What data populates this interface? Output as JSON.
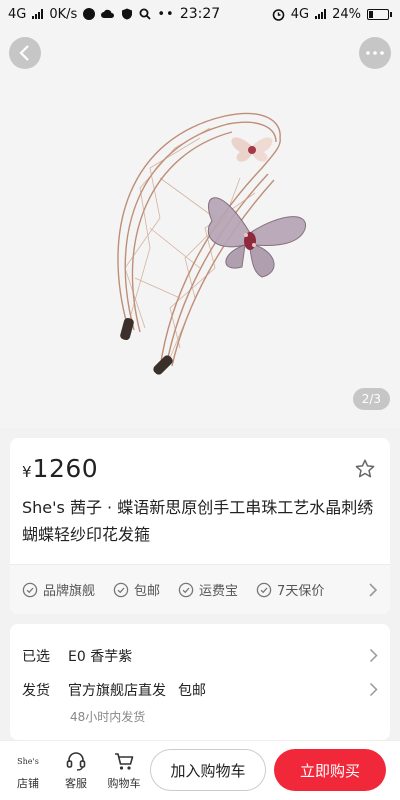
{
  "status_bar": {
    "network": "4G",
    "speed": "0K/s",
    "time": "23:27",
    "network_right": "4G",
    "battery": "24%",
    "battery_level": 0.24
  },
  "gallery": {
    "counter": "2/3",
    "back_icon": "chevron-left-icon",
    "more_icon": "ellipsis-icon"
  },
  "product": {
    "price_symbol": "¥",
    "price": "1260",
    "title": "She's 茜子 · 蝶语新思原创手工串珠工艺水晶刺绣蝴蝶轻纱印花发箍",
    "guarantees": [
      "品牌旗舰",
      "包邮",
      "运费宝",
      "7天保价"
    ]
  },
  "selection": {
    "selected_label": "已选",
    "selected_value": "E0 香芋紫",
    "shipping_label": "发货",
    "shipping_value": "官方旗舰店直发",
    "shipping_extra": "包邮",
    "shipping_time": "48小时内发货"
  },
  "bottom_bar": {
    "shop_logo": "She's",
    "shop_label": "店铺",
    "service_label": "客服",
    "cart_label": "购物车",
    "add_to_cart": "加入购物车",
    "buy_now": "立即购买"
  },
  "colors": {
    "accent": "#f0283a",
    "background": "#f2f2f2"
  }
}
